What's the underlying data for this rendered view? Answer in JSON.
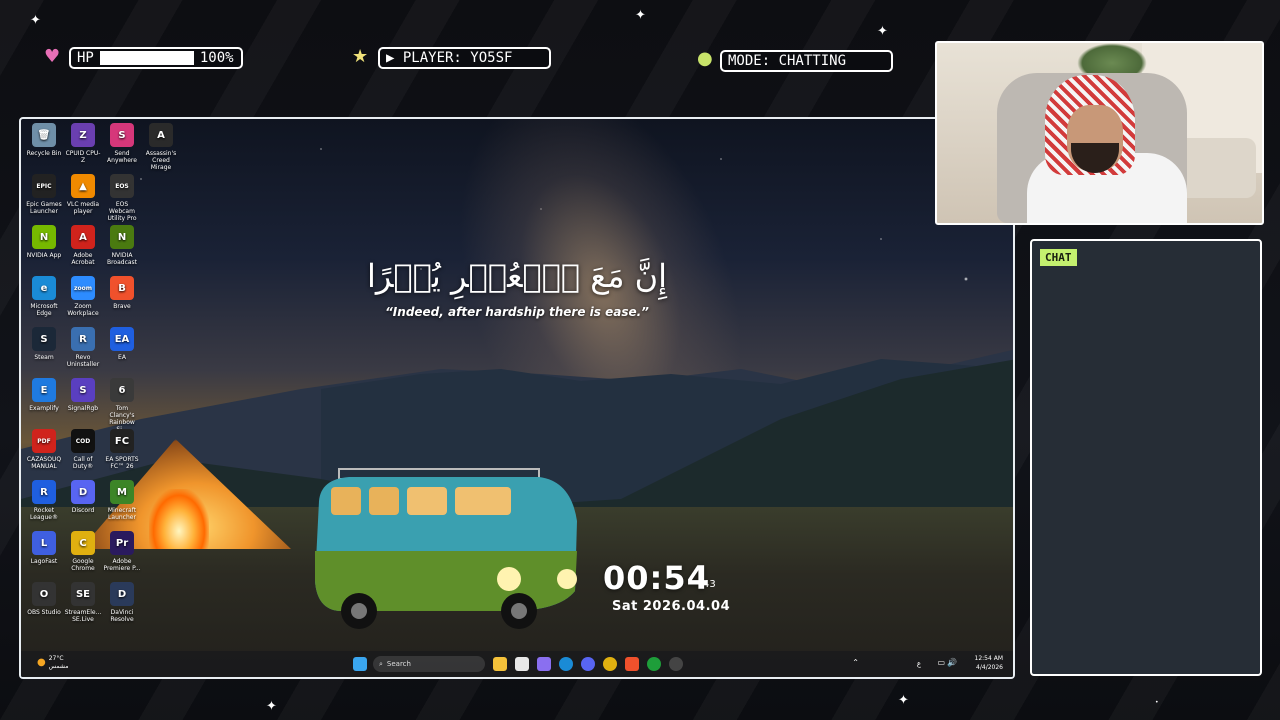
{
  "hud": {
    "hp_label": "HP",
    "hp_value": "100%",
    "hp_level": 1.0,
    "player_label": "▶ PLAYER: YO5SF",
    "mode_label": "MODE: CHATTING",
    "icons": [
      "heart-icon",
      "star-icon",
      "coin-icon"
    ],
    "colors": {
      "heart": "#e86fb7",
      "star": "#f0e27a",
      "coin": "#c8e36a"
    }
  },
  "desktop": {
    "quote_arabic": "إِنَّ مَعَ ٱلۡعُسۡرِ يُسۡرًا",
    "quote_english": "“Indeed, after hardship there is ease.”",
    "clock": {
      "time": "00:54",
      "seconds": "43",
      "date": "Sat  2026.04.04"
    },
    "icons": [
      {
        "label": "Recycle Bin",
        "glyph": "🗑",
        "color": "#6f8fa8"
      },
      {
        "label": "CPUID CPU-Z",
        "glyph": "Z",
        "color": "#6a3fb0"
      },
      {
        "label": "Send Anywhere",
        "glyph": "S",
        "color": "#d6377a"
      },
      {
        "label": "Assassin's Creed Mirage",
        "glyph": "A",
        "color": "#2a2a2a"
      },
      {
        "label": "Epic Games Launcher",
        "glyph": "EPIC",
        "color": "#222"
      },
      {
        "label": "VLC media player",
        "glyph": "▲",
        "color": "#f08a00"
      },
      {
        "label": "EOS Webcam Utility Pro",
        "glyph": "EOS",
        "color": "#333"
      },
      {
        "label": "NVIDIA App",
        "glyph": "N",
        "color": "#76b900"
      },
      {
        "label": "Adobe Acrobat",
        "glyph": "A",
        "color": "#d0231c"
      },
      {
        "label": "NVIDIA Broadcast",
        "glyph": "N",
        "color": "#4a7a10"
      },
      {
        "label": "Microsoft Edge",
        "glyph": "e",
        "color": "#1a8bd6"
      },
      {
        "label": "Zoom Workplace",
        "glyph": "zoom",
        "color": "#2d8cff"
      },
      {
        "label": "Brave",
        "glyph": "B",
        "color": "#f0512c"
      },
      {
        "label": "Steam",
        "glyph": "S",
        "color": "#1b2838"
      },
      {
        "label": "Revo Uninstaller",
        "glyph": "R",
        "color": "#3a6fb0"
      },
      {
        "label": "EA",
        "glyph": "EA",
        "color": "#1f5fe0"
      },
      {
        "label": "Examplify",
        "glyph": "E",
        "color": "#1f7ae0"
      },
      {
        "label": "SignalRgb",
        "glyph": "S",
        "color": "#5a3fc0"
      },
      {
        "label": "Tom Clancy's Rainbow Si...",
        "glyph": "6",
        "color": "#3a3a3a"
      },
      {
        "label": "CAZASOUQ MANUAL",
        "glyph": "PDF",
        "color": "#d0231c"
      },
      {
        "label": "Call of Duty®",
        "glyph": "COD",
        "color": "#111"
      },
      {
        "label": "EA SPORTS FC™ 26",
        "glyph": "FC",
        "color": "#222"
      },
      {
        "label": "Rocket League®",
        "glyph": "R",
        "color": "#1f5fe0"
      },
      {
        "label": "Discord",
        "glyph": "D",
        "color": "#5865f2"
      },
      {
        "label": "Minecraft Launcher",
        "glyph": "M",
        "color": "#3c8527"
      },
      {
        "label": "LagoFast",
        "glyph": "L",
        "color": "#3f5fe0"
      },
      {
        "label": "Google Chrome",
        "glyph": "C",
        "color": "#e0b010"
      },
      {
        "label": "Adobe Premiere P...",
        "glyph": "Pr",
        "color": "#2a1a5e"
      },
      {
        "label": "OBS Studio",
        "glyph": "O",
        "color": "#333"
      },
      {
        "label": "StreamEle... SE.Live",
        "glyph": "SE",
        "color": "#333"
      },
      {
        "label": "DaVinci Resolve",
        "glyph": "D",
        "color": "#2a3a5a"
      }
    ],
    "taskbar": {
      "search_placeholder": "Search",
      "weather_temp": "27°C",
      "weather_desc": "مشمس",
      "tray_time": "12:54 AM",
      "tray_date": "4/4/2026",
      "tray_lang": "ع"
    }
  },
  "chat": {
    "tag": "CHAT"
  }
}
